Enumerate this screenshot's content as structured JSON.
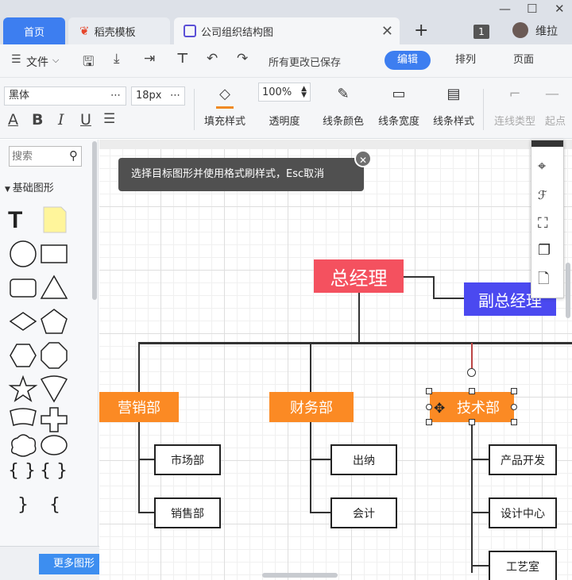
{
  "tabs": {
    "home": "首页",
    "template": "稻壳模板",
    "document": "公司组织结构图"
  },
  "user": {
    "name": "维拉"
  },
  "window": {
    "badge": "1"
  },
  "toolbar": {
    "file": "文件",
    "save_status": "所有更改已保存",
    "modes": [
      "编辑",
      "排列",
      "页面"
    ]
  },
  "format": {
    "font": "黑体",
    "size": "18px",
    "opacity": "100%",
    "fill": "填充样式",
    "alpha": "透明度",
    "line_color": "线条颜色",
    "line_width": "线条宽度",
    "line_style": "线条样式",
    "conn_type": "连线类型",
    "endpoint": "起点"
  },
  "sidebar": {
    "search_placeholder": "搜索",
    "section": "基础图形",
    "more": "更多图形"
  },
  "tooltip": "选择目标图形并使用格式刷样式，Esc取消",
  "chart": {
    "ceo": "总经理",
    "vp": "副总经理",
    "depts": [
      "营销部",
      "财务部",
      "技术部"
    ],
    "marketing_sub": [
      "市场部",
      "销售部"
    ],
    "finance_sub": [
      "出纳",
      "会计"
    ],
    "tech_sub": [
      "产品开发",
      "设计中心",
      "工艺室"
    ]
  },
  "colors": {
    "accent": "#3d7ef0",
    "ceo": "#f4515f",
    "vp": "#4b49f0",
    "dept": "#fb8a24"
  }
}
